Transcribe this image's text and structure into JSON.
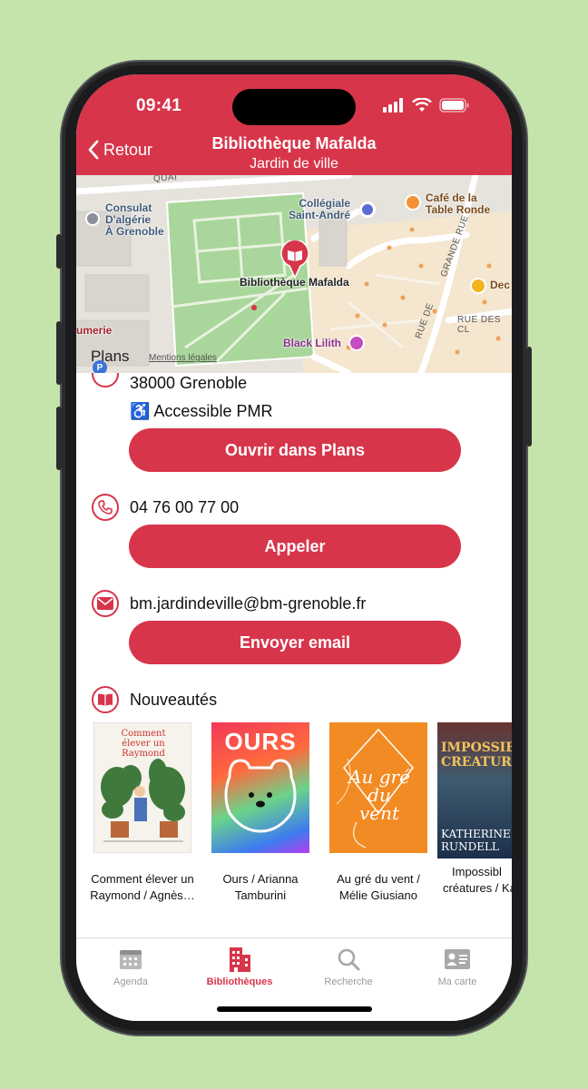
{
  "status": {
    "time": "09:41"
  },
  "nav": {
    "back_label": "Retour",
    "title": "Bibliothèque Mafalda",
    "subtitle": "Jardin de ville"
  },
  "map": {
    "labels": {
      "consulat": "Consulat\nD'algérie\nÀ Grenoble",
      "collegiale": "Collégiale\nSaint-André",
      "cafe": "Café de la\nTable Ronde",
      "bibliotheque": "Bibliothèque Mafalda",
      "black_lilith": "Black Lilith",
      "parfumerie": "umerie",
      "deco": "Dec",
      "grande_rue": "GRANDE RUE",
      "rue_des": "RUE DES CL",
      "quai": "QUAI",
      "rue_de": "RUE DE"
    },
    "brand": "Plans",
    "legal": "Mentions légales"
  },
  "address": {
    "city": "38000 Grenoble",
    "accessibility": "♿ Accessible PMR",
    "open_maps_label": "Ouvrir dans Plans"
  },
  "phone": {
    "number": "04 76 00 77 00",
    "call_label": "Appeler"
  },
  "email": {
    "address": "bm.jardindeville@bm-grenoble.fr",
    "send_label": "Envoyer email"
  },
  "news": {
    "title": "Nouveautés",
    "books": [
      {
        "line1": "Comment élever un",
        "line2": "Raymond / Agnès…",
        "cover_text": "Comment élever un Raymond"
      },
      {
        "line1": "Ours / Arianna",
        "line2": "Tamburini",
        "cover_text": "OURS"
      },
      {
        "line1": "Au gré du vent /",
        "line2": "Mélie Giusiano",
        "cover_text": "Au gré du vent"
      },
      {
        "line1": "Impossibl",
        "line2": "créatures / Ka",
        "cover_text": "IMPOSSIBLE CREATURES",
        "cover_author": "KATHERINE RUNDELL"
      }
    ]
  },
  "tabs": [
    {
      "label": "Agenda",
      "icon": "calendar-icon",
      "active": false
    },
    {
      "label": "Bibliothèques",
      "icon": "building-icon",
      "active": true
    },
    {
      "label": "Recherche",
      "icon": "search-icon",
      "active": false
    },
    {
      "label": "Ma carte",
      "icon": "id-card-icon",
      "active": false
    }
  ],
  "colors": {
    "accent": "#d7354a",
    "background": "#c5e4ab"
  }
}
